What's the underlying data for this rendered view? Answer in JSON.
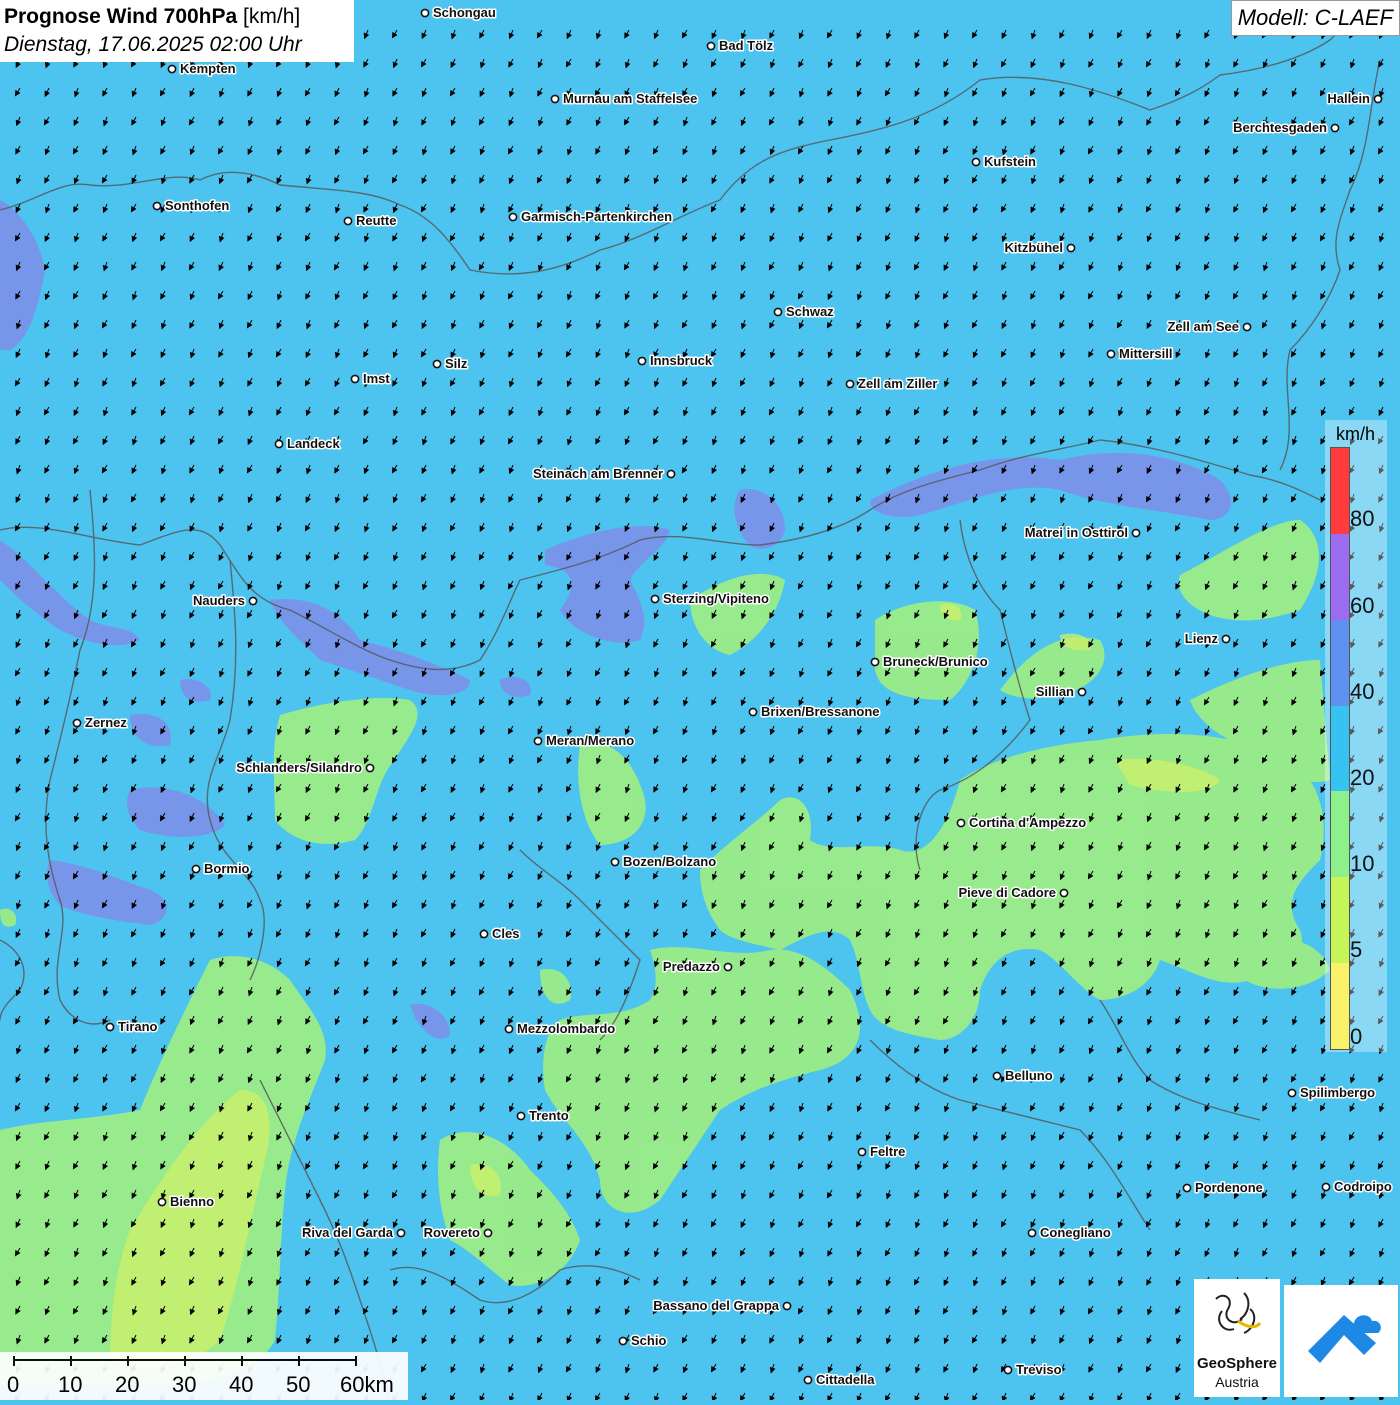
{
  "header": {
    "title_main": "Prognose Wind 700hPa",
    "title_unit": "[km/h]",
    "date": "Dienstag, 17.06.2025 02:00 Uhr",
    "model": "Modell: C-LAEF"
  },
  "legend": {
    "unit": "km/h",
    "ticks": [
      "80",
      "60",
      "40",
      "20",
      "10",
      "5",
      "0"
    ],
    "colors": [
      "#ff3b3b",
      "#9b6bf0",
      "#5f92ef",
      "#36c3f2",
      "#8ef08a",
      "#c6f55a",
      "#f7f26a"
    ]
  },
  "scalebar": {
    "labels": [
      "0",
      "10",
      "20",
      "30",
      "40",
      "50",
      "60km"
    ]
  },
  "logos": {
    "geosphere_name": "GeoSphere",
    "geosphere_sub": "Austria"
  },
  "cities": [
    {
      "name": "Schongau"
    },
    {
      "name": "Kempten"
    },
    {
      "name": "Bad Tölz"
    },
    {
      "name": "Murnau am Staffelsee"
    },
    {
      "name": "Hallein"
    },
    {
      "name": "Berchtesgaden"
    },
    {
      "name": "Kufstein"
    },
    {
      "name": "Sonthofen"
    },
    {
      "name": "Reutte"
    },
    {
      "name": "Garmisch-Partenkirchen"
    },
    {
      "name": "Kitzbühel"
    },
    {
      "name": "Schwaz"
    },
    {
      "name": "Zell am See"
    },
    {
      "name": "Mittersill"
    },
    {
      "name": "Innsbruck"
    },
    {
      "name": "Imst"
    },
    {
      "name": "Silz"
    },
    {
      "name": "Zell am Ziller"
    },
    {
      "name": "Landeck"
    },
    {
      "name": "Steinach am Brenner"
    },
    {
      "name": "Matrei in Osttirol"
    },
    {
      "name": "Nauders"
    },
    {
      "name": "Sterzing/Vipiteno"
    },
    {
      "name": "Lienz"
    },
    {
      "name": "Bruneck/Brunico"
    },
    {
      "name": "Sillian"
    },
    {
      "name": "Zernez"
    },
    {
      "name": "Brixen/Bressanone"
    },
    {
      "name": "Meran/Merano"
    },
    {
      "name": "Schlanders/Silandro"
    },
    {
      "name": "Cortina d'Ampezzo"
    },
    {
      "name": "Bormio"
    },
    {
      "name": "Bozen/Bolzano"
    },
    {
      "name": "Pieve di Cadore"
    },
    {
      "name": "Cles"
    },
    {
      "name": "Predazzo"
    },
    {
      "name": "Tirano"
    },
    {
      "name": "Mezzolombardo"
    },
    {
      "name": "Belluno"
    },
    {
      "name": "Spilimbergo"
    },
    {
      "name": "Trento"
    },
    {
      "name": "Feltre"
    },
    {
      "name": "Pordenone"
    },
    {
      "name": "Codroipo"
    },
    {
      "name": "Bienno"
    },
    {
      "name": "Riva del Garda"
    },
    {
      "name": "Rovereto"
    },
    {
      "name": "Conegliano"
    },
    {
      "name": "Bassano del Grappa"
    },
    {
      "name": "Schio"
    },
    {
      "name": "Cittadella"
    },
    {
      "name": "Treviso"
    }
  ]
}
